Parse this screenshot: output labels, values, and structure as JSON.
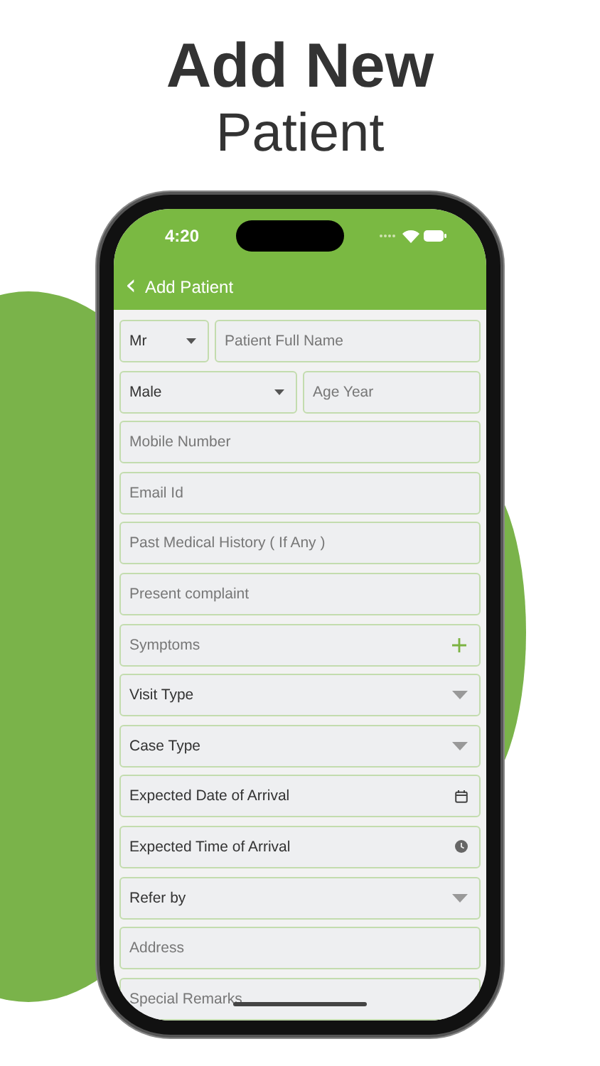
{
  "headline": {
    "line_1": "Add New",
    "line_2": "Patient"
  },
  "status_bar": {
    "time": "4:20"
  },
  "header": {
    "back_icon": "‹",
    "title": "Add Patient"
  },
  "form_rows": [
    [
      {
        "kind": "select",
        "value": "Mr"
      },
      {
        "kind": "text",
        "placeholder": "Patient Full Name"
      }
    ],
    [
      {
        "kind": "select",
        "value": "Male"
      },
      {
        "kind": "text",
        "placeholder": "Age Year"
      }
    ],
    [
      {
        "kind": "text",
        "placeholder": "Mobile Number"
      }
    ],
    [
      {
        "kind": "text",
        "placeholder": "Email Id"
      }
    ],
    [
      {
        "kind": "text",
        "placeholder": "Past Medical History ( If Any )"
      }
    ],
    [
      {
        "kind": "text",
        "placeholder": "Present complaint"
      }
    ],
    [
      {
        "kind": "add",
        "placeholder": "Symptoms"
      }
    ],
    [
      {
        "kind": "dropdown",
        "value": "Visit Type"
      }
    ],
    [
      {
        "kind": "dropdown",
        "value": "Case Type"
      }
    ],
    [
      {
        "kind": "date",
        "value": "Expected Date of Arrival"
      }
    ],
    [
      {
        "kind": "time",
        "value": "Expected Time of Arrival"
      }
    ],
    [
      {
        "kind": "dropdown",
        "value": "Refer by"
      }
    ],
    [
      {
        "kind": "text",
        "placeholder": "Address"
      }
    ],
    [
      {
        "kind": "text",
        "placeholder": "Special Remarks"
      }
    ]
  ]
}
